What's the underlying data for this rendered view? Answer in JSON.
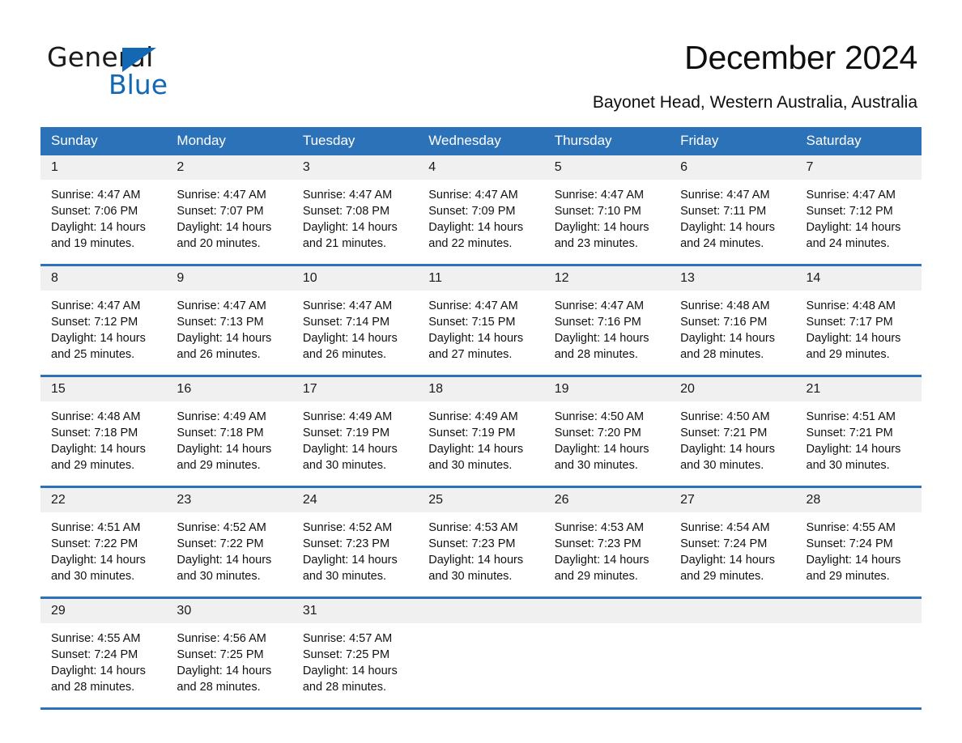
{
  "brand": {
    "name_part1": "General",
    "name_part2": "Blue",
    "logo_icon": "triangle-logo-icon",
    "accent_color": "#1368b4"
  },
  "header": {
    "title": "December 2024",
    "subtitle": "Bayonet Head, Western Australia, Australia"
  },
  "calendar": {
    "header_bg": "#2c72b8",
    "daynum_bg": "#f0f0f0",
    "weekday_names": [
      "Sunday",
      "Monday",
      "Tuesday",
      "Wednesday",
      "Thursday",
      "Friday",
      "Saturday"
    ],
    "weeks": [
      [
        {
          "day": "1",
          "sunrise": "Sunrise: 4:47 AM",
          "sunset": "Sunset: 7:06 PM",
          "daylight_line1": "Daylight: 14 hours",
          "daylight_line2": "and 19 minutes."
        },
        {
          "day": "2",
          "sunrise": "Sunrise: 4:47 AM",
          "sunset": "Sunset: 7:07 PM",
          "daylight_line1": "Daylight: 14 hours",
          "daylight_line2": "and 20 minutes."
        },
        {
          "day": "3",
          "sunrise": "Sunrise: 4:47 AM",
          "sunset": "Sunset: 7:08 PM",
          "daylight_line1": "Daylight: 14 hours",
          "daylight_line2": "and 21 minutes."
        },
        {
          "day": "4",
          "sunrise": "Sunrise: 4:47 AM",
          "sunset": "Sunset: 7:09 PM",
          "daylight_line1": "Daylight: 14 hours",
          "daylight_line2": "and 22 minutes."
        },
        {
          "day": "5",
          "sunrise": "Sunrise: 4:47 AM",
          "sunset": "Sunset: 7:10 PM",
          "daylight_line1": "Daylight: 14 hours",
          "daylight_line2": "and 23 minutes."
        },
        {
          "day": "6",
          "sunrise": "Sunrise: 4:47 AM",
          "sunset": "Sunset: 7:11 PM",
          "daylight_line1": "Daylight: 14 hours",
          "daylight_line2": "and 24 minutes."
        },
        {
          "day": "7",
          "sunrise": "Sunrise: 4:47 AM",
          "sunset": "Sunset: 7:12 PM",
          "daylight_line1": "Daylight: 14 hours",
          "daylight_line2": "and 24 minutes."
        }
      ],
      [
        {
          "day": "8",
          "sunrise": "Sunrise: 4:47 AM",
          "sunset": "Sunset: 7:12 PM",
          "daylight_line1": "Daylight: 14 hours",
          "daylight_line2": "and 25 minutes."
        },
        {
          "day": "9",
          "sunrise": "Sunrise: 4:47 AM",
          "sunset": "Sunset: 7:13 PM",
          "daylight_line1": "Daylight: 14 hours",
          "daylight_line2": "and 26 minutes."
        },
        {
          "day": "10",
          "sunrise": "Sunrise: 4:47 AM",
          "sunset": "Sunset: 7:14 PM",
          "daylight_line1": "Daylight: 14 hours",
          "daylight_line2": "and 26 minutes."
        },
        {
          "day": "11",
          "sunrise": "Sunrise: 4:47 AM",
          "sunset": "Sunset: 7:15 PM",
          "daylight_line1": "Daylight: 14 hours",
          "daylight_line2": "and 27 minutes."
        },
        {
          "day": "12",
          "sunrise": "Sunrise: 4:47 AM",
          "sunset": "Sunset: 7:16 PM",
          "daylight_line1": "Daylight: 14 hours",
          "daylight_line2": "and 28 minutes."
        },
        {
          "day": "13",
          "sunrise": "Sunrise: 4:48 AM",
          "sunset": "Sunset: 7:16 PM",
          "daylight_line1": "Daylight: 14 hours",
          "daylight_line2": "and 28 minutes."
        },
        {
          "day": "14",
          "sunrise": "Sunrise: 4:48 AM",
          "sunset": "Sunset: 7:17 PM",
          "daylight_line1": "Daylight: 14 hours",
          "daylight_line2": "and 29 minutes."
        }
      ],
      [
        {
          "day": "15",
          "sunrise": "Sunrise: 4:48 AM",
          "sunset": "Sunset: 7:18 PM",
          "daylight_line1": "Daylight: 14 hours",
          "daylight_line2": "and 29 minutes."
        },
        {
          "day": "16",
          "sunrise": "Sunrise: 4:49 AM",
          "sunset": "Sunset: 7:18 PM",
          "daylight_line1": "Daylight: 14 hours",
          "daylight_line2": "and 29 minutes."
        },
        {
          "day": "17",
          "sunrise": "Sunrise: 4:49 AM",
          "sunset": "Sunset: 7:19 PM",
          "daylight_line1": "Daylight: 14 hours",
          "daylight_line2": "and 30 minutes."
        },
        {
          "day": "18",
          "sunrise": "Sunrise: 4:49 AM",
          "sunset": "Sunset: 7:19 PM",
          "daylight_line1": "Daylight: 14 hours",
          "daylight_line2": "and 30 minutes."
        },
        {
          "day": "19",
          "sunrise": "Sunrise: 4:50 AM",
          "sunset": "Sunset: 7:20 PM",
          "daylight_line1": "Daylight: 14 hours",
          "daylight_line2": "and 30 minutes."
        },
        {
          "day": "20",
          "sunrise": "Sunrise: 4:50 AM",
          "sunset": "Sunset: 7:21 PM",
          "daylight_line1": "Daylight: 14 hours",
          "daylight_line2": "and 30 minutes."
        },
        {
          "day": "21",
          "sunrise": "Sunrise: 4:51 AM",
          "sunset": "Sunset: 7:21 PM",
          "daylight_line1": "Daylight: 14 hours",
          "daylight_line2": "and 30 minutes."
        }
      ],
      [
        {
          "day": "22",
          "sunrise": "Sunrise: 4:51 AM",
          "sunset": "Sunset: 7:22 PM",
          "daylight_line1": "Daylight: 14 hours",
          "daylight_line2": "and 30 minutes."
        },
        {
          "day": "23",
          "sunrise": "Sunrise: 4:52 AM",
          "sunset": "Sunset: 7:22 PM",
          "daylight_line1": "Daylight: 14 hours",
          "daylight_line2": "and 30 minutes."
        },
        {
          "day": "24",
          "sunrise": "Sunrise: 4:52 AM",
          "sunset": "Sunset: 7:23 PM",
          "daylight_line1": "Daylight: 14 hours",
          "daylight_line2": "and 30 minutes."
        },
        {
          "day": "25",
          "sunrise": "Sunrise: 4:53 AM",
          "sunset": "Sunset: 7:23 PM",
          "daylight_line1": "Daylight: 14 hours",
          "daylight_line2": "and 30 minutes."
        },
        {
          "day": "26",
          "sunrise": "Sunrise: 4:53 AM",
          "sunset": "Sunset: 7:23 PM",
          "daylight_line1": "Daylight: 14 hours",
          "daylight_line2": "and 29 minutes."
        },
        {
          "day": "27",
          "sunrise": "Sunrise: 4:54 AM",
          "sunset": "Sunset: 7:24 PM",
          "daylight_line1": "Daylight: 14 hours",
          "daylight_line2": "and 29 minutes."
        },
        {
          "day": "28",
          "sunrise": "Sunrise: 4:55 AM",
          "sunset": "Sunset: 7:24 PM",
          "daylight_line1": "Daylight: 14 hours",
          "daylight_line2": "and 29 minutes."
        }
      ],
      [
        {
          "day": "29",
          "sunrise": "Sunrise: 4:55 AM",
          "sunset": "Sunset: 7:24 PM",
          "daylight_line1": "Daylight: 14 hours",
          "daylight_line2": "and 28 minutes."
        },
        {
          "day": "30",
          "sunrise": "Sunrise: 4:56 AM",
          "sunset": "Sunset: 7:25 PM",
          "daylight_line1": "Daylight: 14 hours",
          "daylight_line2": "and 28 minutes."
        },
        {
          "day": "31",
          "sunrise": "Sunrise: 4:57 AM",
          "sunset": "Sunset: 7:25 PM",
          "daylight_line1": "Daylight: 14 hours",
          "daylight_line2": "and 28 minutes."
        },
        {
          "day": "",
          "sunrise": "",
          "sunset": "",
          "daylight_line1": "",
          "daylight_line2": ""
        },
        {
          "day": "",
          "sunrise": "",
          "sunset": "",
          "daylight_line1": "",
          "daylight_line2": ""
        },
        {
          "day": "",
          "sunrise": "",
          "sunset": "",
          "daylight_line1": "",
          "daylight_line2": ""
        },
        {
          "day": "",
          "sunrise": "",
          "sunset": "",
          "daylight_line1": "",
          "daylight_line2": ""
        }
      ]
    ]
  }
}
